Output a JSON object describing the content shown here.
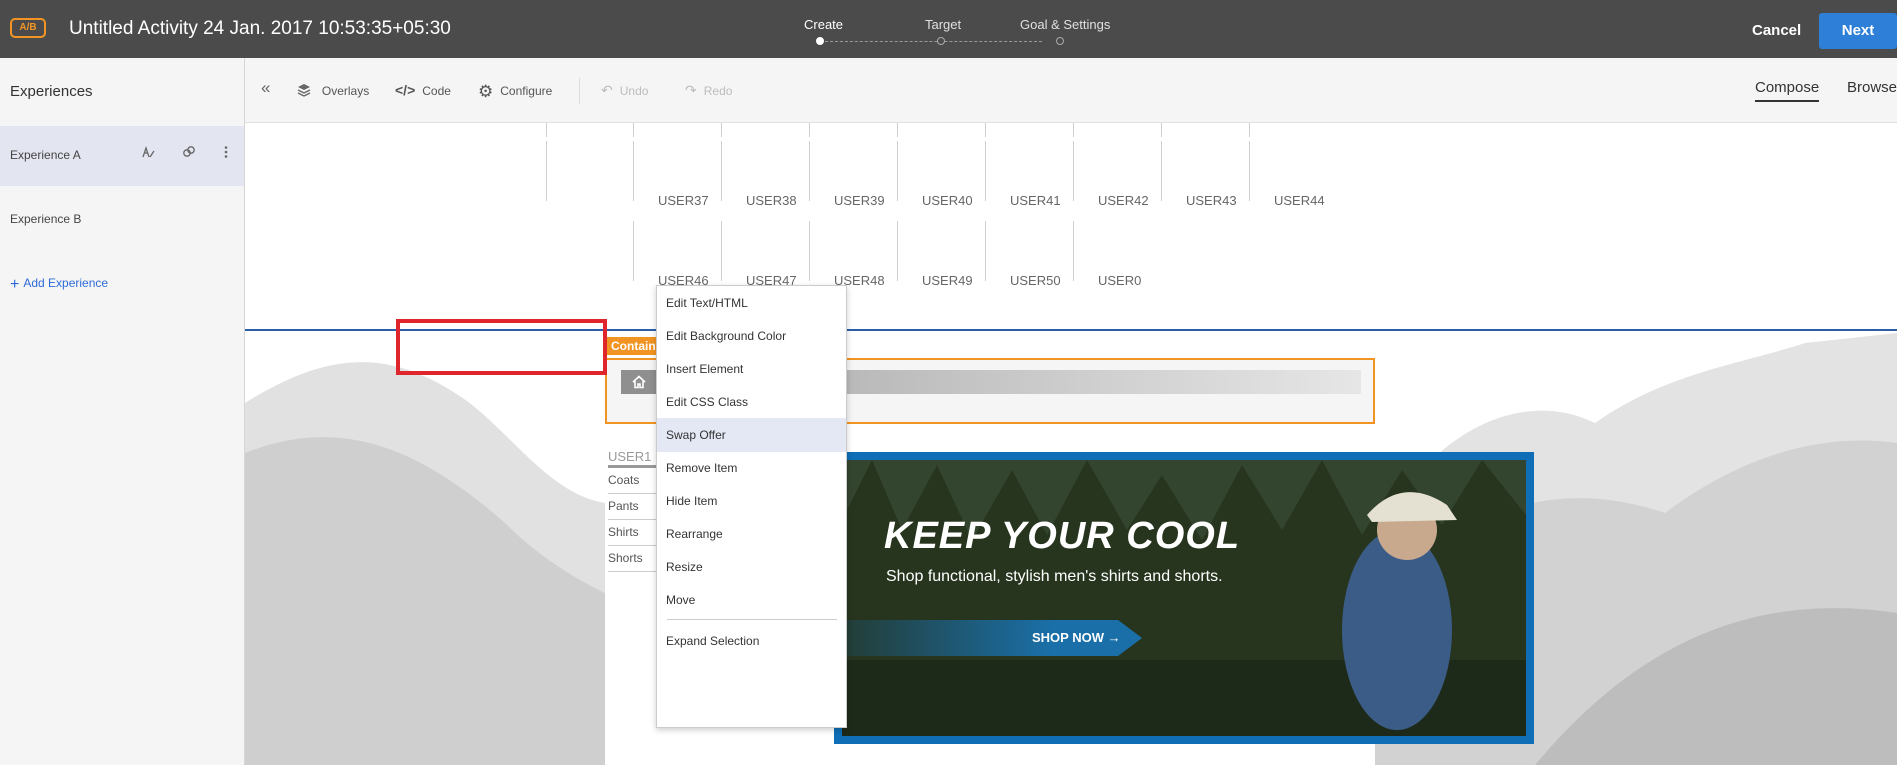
{
  "topbar": {
    "badge": "A/B",
    "title": "Untitled Activity 24 Jan. 2017 10:53:35+05:30",
    "steps": [
      "Create",
      "Target",
      "Goal & Settings"
    ],
    "cancel_label": "Cancel",
    "next_label": "Next"
  },
  "sidebar": {
    "header": "Experiences",
    "experiences": [
      {
        "label": "Experience A",
        "active": true
      },
      {
        "label": "Experience B",
        "active": false
      }
    ],
    "add_label": "Add Experience"
  },
  "toolbar": {
    "overlays": "Overlays",
    "code": "Code",
    "configure": "Configure",
    "undo": "Undo",
    "redo": "Redo",
    "compose": "Compose",
    "browse": "Browse"
  },
  "grid": {
    "row1": [
      "USER37",
      "USER38",
      "USER39",
      "USER40",
      "USER41",
      "USER42",
      "USER43",
      "USER44"
    ],
    "row2": [
      "USER46",
      "USER47",
      "USER48",
      "USER49",
      "USER50",
      "USER0"
    ]
  },
  "container": {
    "tag": "Container",
    "breadcrumb": "user1"
  },
  "categories": {
    "header": "USER1",
    "items": [
      "Coats",
      "Pants",
      "Shirts",
      "Shorts"
    ]
  },
  "banner": {
    "headline": "KEEP YOUR COOL",
    "subtext": "Shop functional, stylish men's shirts and shorts.",
    "cta": "SHOP NOW →"
  },
  "context_menu": {
    "items": [
      "Edit Text/HTML",
      "Edit Background Color",
      "Insert Element",
      "Edit CSS Class",
      "Swap Offer",
      "Remove Item",
      "Hide Item",
      "Rearrange",
      "Resize",
      "Move"
    ],
    "footer_item": "Expand Selection",
    "highlighted": "Swap Offer"
  },
  "colors": {
    "topbar": "#4b4b4b",
    "accent_orange": "#f29423",
    "next_blue": "#2d7fd8",
    "highlight_red": "#e0262d",
    "banner_border": "#0f6eb5"
  }
}
